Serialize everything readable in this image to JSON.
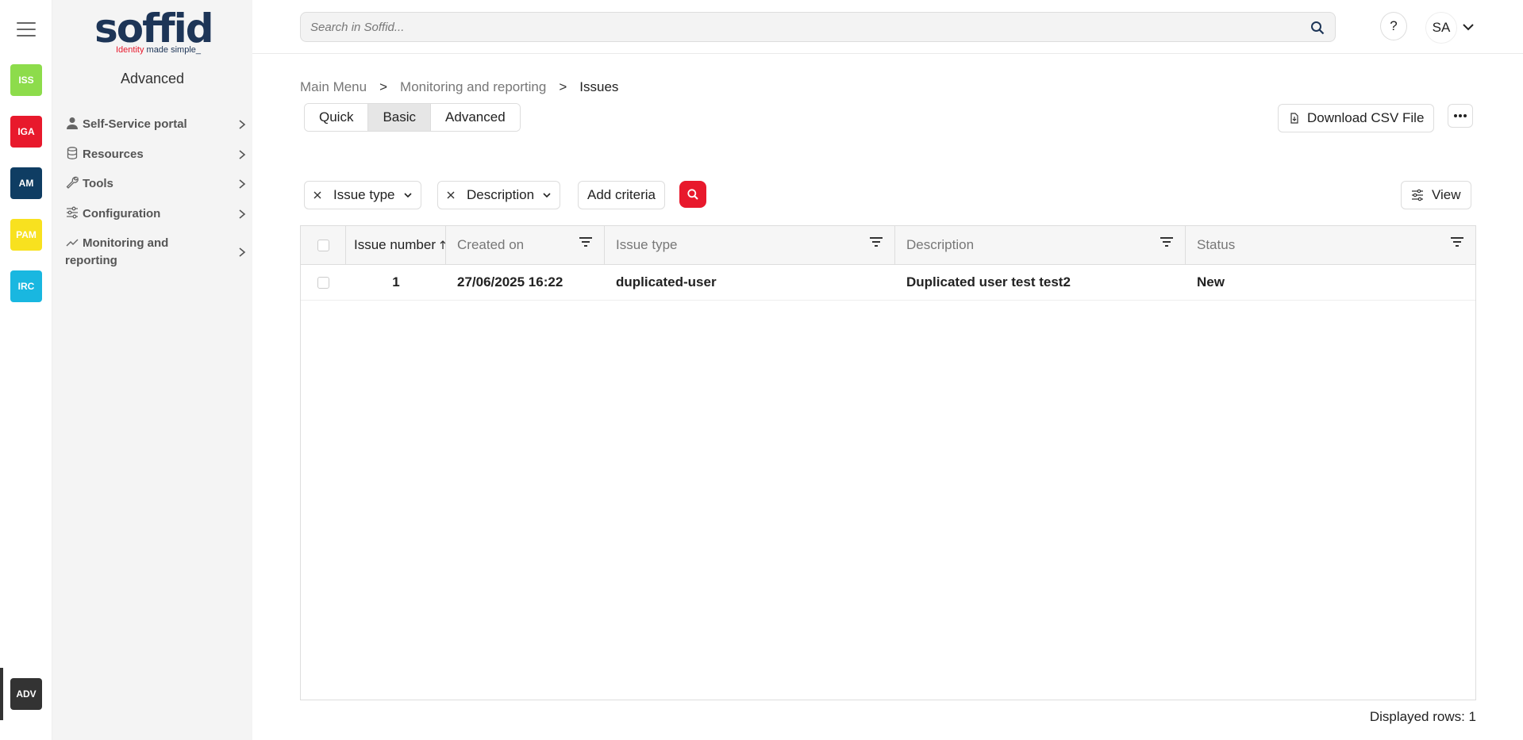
{
  "rail": {
    "apps": [
      {
        "label": "ISS",
        "color": "#8ddc4b"
      },
      {
        "label": "IGA",
        "color": "#e8192c"
      },
      {
        "label": "AM",
        "color": "#0f3d63"
      },
      {
        "label": "PAM",
        "color": "#f8e11f"
      },
      {
        "label": "IRC",
        "color": "#19b7e0"
      }
    ],
    "active_app": {
      "label": "ADV",
      "color": "#333333"
    }
  },
  "logo": {
    "word": "soffid",
    "tag_red": "Identity",
    "tag_blue": "made simple_"
  },
  "sidebar": {
    "title": "Advanced",
    "items": [
      {
        "label": "Self-Service portal",
        "icon": "person-icon"
      },
      {
        "label": "Resources",
        "icon": "database-icon"
      },
      {
        "label": "Tools",
        "icon": "wrench-icon"
      },
      {
        "label": "Configuration",
        "icon": "sliders-icon"
      },
      {
        "label": "Monitoring and reporting",
        "icon": "chart-line-icon"
      }
    ]
  },
  "header": {
    "search_placeholder": "Search in Soffid...",
    "help_label": "?",
    "user_initials": "SA"
  },
  "breadcrumb": {
    "items": [
      "Main Menu",
      "Monitoring and reporting",
      "Issues"
    ],
    "separator": ">"
  },
  "tabs": [
    {
      "label": "Quick"
    },
    {
      "label": "Basic"
    },
    {
      "label": "Advanced"
    }
  ],
  "active_tab": "Basic",
  "actions": {
    "download_csv": "Download CSV File",
    "view": "View"
  },
  "filters": {
    "chips": [
      {
        "label": "Issue type"
      },
      {
        "label": "Description"
      }
    ],
    "add_criteria": "Add criteria"
  },
  "table": {
    "columns": [
      "Issue number",
      "Created on",
      "Issue type",
      "Description",
      "Status"
    ],
    "rows": [
      {
        "number": "1",
        "created": "27/06/2025 16:22",
        "type": "duplicated-user",
        "description": "Duplicated user test test2",
        "status": "New"
      }
    ],
    "footer": "Displayed rows: 1"
  }
}
